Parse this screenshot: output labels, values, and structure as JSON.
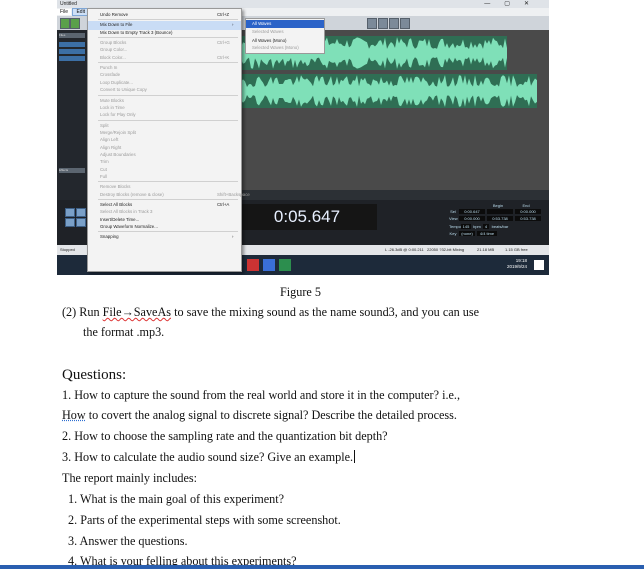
{
  "screenshot": {
    "window_title": "Untitled",
    "window_controls": [
      "—",
      "▢",
      "✕"
    ],
    "menubar": [
      "File",
      "Edit"
    ],
    "left_panel_labels": [
      "Files",
      "Effects"
    ],
    "time_display": "0:05.647",
    "status_left": "Stopped",
    "status_right": [
      "L -26.3dB @ 0:00.211",
      "22050 ?32-bit Mixing",
      "21.18 MB",
      "1.15 GB free"
    ],
    "transport_info": {
      "headers": [
        "Begin",
        "End",
        "Length"
      ],
      "sel_row": [
        "Sel",
        "0:00.647",
        "",
        "0:00.000"
      ],
      "view_row": [
        "View",
        "0:00.000",
        "0:53.738",
        "0:53.738"
      ],
      "tempo": [
        "Tempo",
        "145",
        "bpm",
        "4",
        "beats/bar"
      ],
      "key": [
        "Key",
        "(none)",
        "4/4 time"
      ]
    },
    "clock_time": "19:18",
    "clock_date": "2019/9/24",
    "edit_menu": [
      {
        "label": "Undo Remove",
        "shortcut": "Ctrl+Z",
        "state": "normal"
      },
      {
        "sep": true
      },
      {
        "label": "Mix Down to File",
        "shortcut": "",
        "arrow": "›",
        "state": "highlight"
      },
      {
        "label": "Mix Down to Empty Track 3 (Bounce)",
        "shortcut": "",
        "state": "normal"
      },
      {
        "sep": true
      },
      {
        "label": "Group Blocks",
        "shortcut": "Ctrl+G",
        "state": "disabled"
      },
      {
        "label": "Group Color...",
        "shortcut": "",
        "state": "disabled"
      },
      {
        "label": "Block Color...",
        "shortcut": "Ctrl+K",
        "state": "disabled"
      },
      {
        "sep": true
      },
      {
        "label": "Punch In",
        "shortcut": "",
        "state": "disabled"
      },
      {
        "label": "Crossfade",
        "shortcut": "",
        "state": "disabled"
      },
      {
        "label": "Loop Duplicate...",
        "shortcut": "",
        "state": "disabled"
      },
      {
        "label": "Convert to Unique Copy",
        "shortcut": "",
        "state": "disabled"
      },
      {
        "sep": true
      },
      {
        "label": "Mute Blocks",
        "shortcut": "",
        "state": "disabled"
      },
      {
        "label": "Lock in Time",
        "shortcut": "",
        "state": "disabled"
      },
      {
        "label": "Lock for Play Only",
        "shortcut": "",
        "state": "disabled"
      },
      {
        "sep": true
      },
      {
        "label": "Split",
        "shortcut": "",
        "state": "disabled"
      },
      {
        "label": "Merge/Rejoin Split",
        "shortcut": "",
        "state": "disabled"
      },
      {
        "label": "Align Left",
        "shortcut": "",
        "state": "disabled"
      },
      {
        "label": "Align Right",
        "shortcut": "",
        "state": "disabled"
      },
      {
        "label": "Adjust Boundaries",
        "shortcut": "",
        "state": "disabled"
      },
      {
        "label": "Trim",
        "shortcut": "",
        "state": "disabled"
      },
      {
        "label": "Cut",
        "shortcut": "",
        "state": "disabled"
      },
      {
        "label": "Full",
        "shortcut": "",
        "state": "disabled"
      },
      {
        "sep": true
      },
      {
        "label": "Remove Blocks",
        "shortcut": "",
        "state": "disabled"
      },
      {
        "label": "Destroy Blocks (remove & close)",
        "shortcut": "Shift+Backspace",
        "state": "disabled"
      },
      {
        "sep": true
      },
      {
        "label": "Select All Blocks",
        "shortcut": "Ctrl+A",
        "state": "normal"
      },
      {
        "label": "Select All Blocks in Track 3",
        "shortcut": "",
        "state": "disabled"
      },
      {
        "label": "Insert/Delete Time...",
        "shortcut": "",
        "state": "normal"
      },
      {
        "label": "Group Waveform Normalize...",
        "shortcut": "",
        "state": "normal"
      },
      {
        "sep": true
      },
      {
        "label": "Snapping",
        "shortcut": "",
        "arrow": "›",
        "state": "normal"
      }
    ],
    "submenu": [
      {
        "label": "All Waves",
        "state": "highlight"
      },
      {
        "label": "Selected Waves",
        "state": "disabled"
      },
      {
        "label": "All Waves (Mono)",
        "state": "normal"
      },
      {
        "label": "Selected Waves (Mono)",
        "state": "disabled"
      }
    ]
  },
  "document": {
    "figure_caption": "Figure 5",
    "step2_prefix": "(2)  Run ",
    "step2_link": "File→SaveAs",
    "step2_rest": " to save the mixing sound as the name sound3, and you can use",
    "step2_line2": "the format .mp3.",
    "questions_heading": "Questions:",
    "q1_line1": "1. How to capture the sound from the real world and store it in the computer? i.e.,",
    "q1_how": "How",
    "q1_line2_rest": " to covert the analog signal to discrete signal? Describe the detailed process.",
    "q2": "2. How to choose the sampling rate and the quantization bit depth?",
    "q3": "3. How to calculate the audio sound size? Give an example.",
    "report_intro": "The report mainly includes:",
    "report_items": [
      "1.   What is the main goal of this experiment?",
      "2.   Parts of the experimental steps with some screenshot.",
      "3.   Answer the questions.",
      "4.   What is your felling about this experiments?"
    ]
  }
}
